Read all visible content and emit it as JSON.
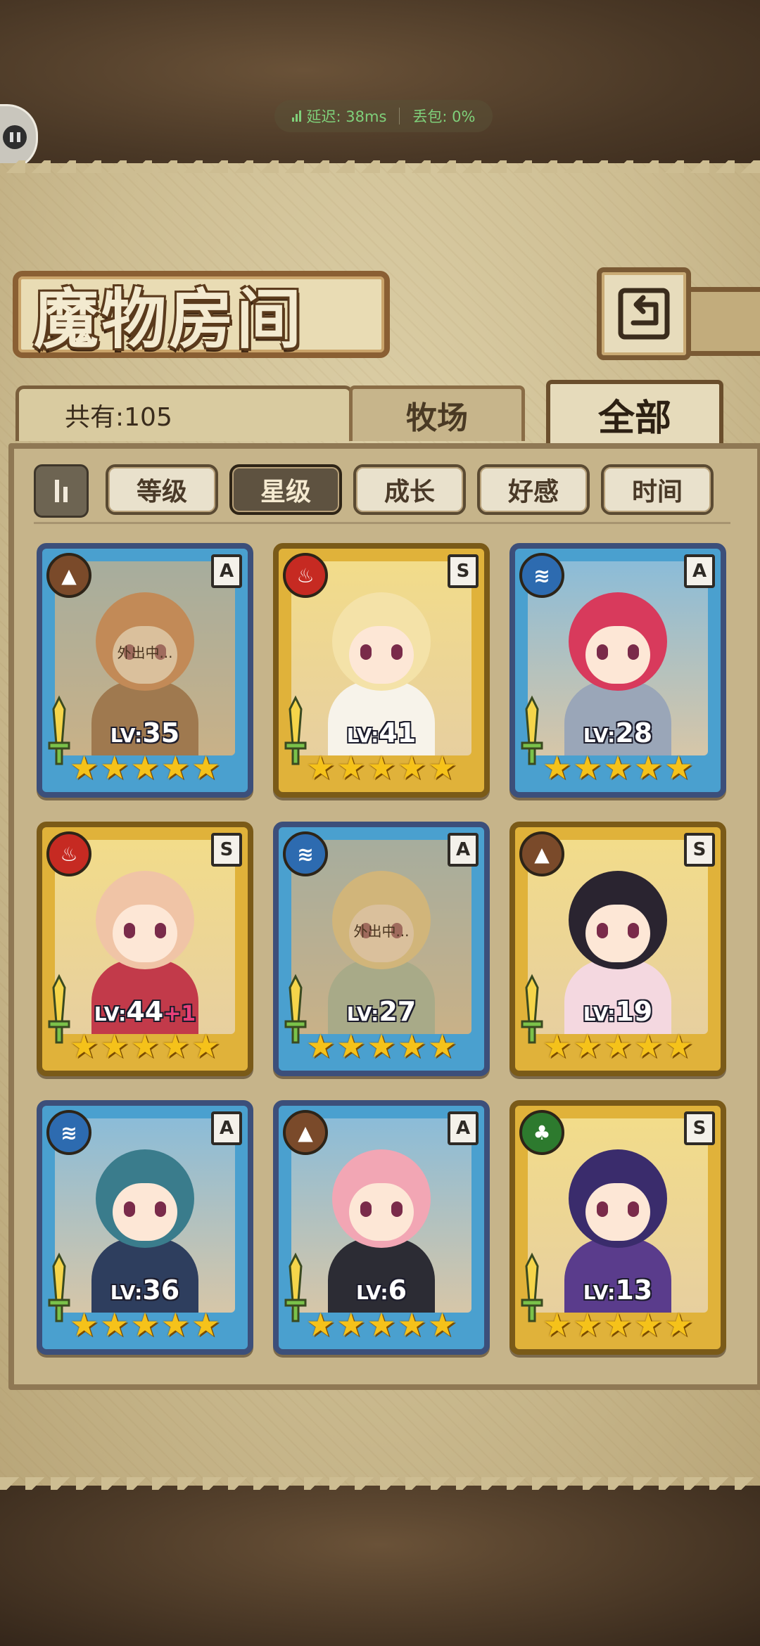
{
  "net_status": {
    "latency_label": "延迟: 38ms",
    "loss_label": "丢包: 0%"
  },
  "header": {
    "title": "魔物房间"
  },
  "count": {
    "label": "共有:105"
  },
  "tabs": [
    {
      "label": "牧场"
    },
    {
      "label": "全部",
      "active": true
    }
  ],
  "sort_buttons": [
    {
      "label": "等级",
      "active": false
    },
    {
      "label": "星级",
      "active": true
    },
    {
      "label": "成长",
      "active": false
    },
    {
      "label": "好感",
      "active": false
    },
    {
      "label": "时间",
      "active": false
    }
  ],
  "away_label": "外出中...",
  "monsters": [
    {
      "element": "earth",
      "rank": "A",
      "level_prefix": "LV:",
      "level": "35",
      "bonus": "",
      "stars": 5,
      "away": true,
      "hair": "#c8703c",
      "outfit": "#7a4a2a"
    },
    {
      "element": "fire",
      "rank": "S",
      "level_prefix": "LV:",
      "level": "41",
      "bonus": "",
      "stars": 5,
      "away": false,
      "hair": "#f4e2a8",
      "outfit": "#f7f3ea"
    },
    {
      "element": "water",
      "rank": "A",
      "level_prefix": "LV:",
      "level": "28",
      "bonus": "",
      "stars": 5,
      "away": false,
      "hair": "#d83a5c",
      "outfit": "#9aa6b8"
    },
    {
      "element": "fire",
      "rank": "S",
      "level_prefix": "LV:",
      "level": "44",
      "bonus": "+1",
      "stars": 5,
      "away": false,
      "hair": "#f0c4a6",
      "outfit": "#c23a4a"
    },
    {
      "element": "water",
      "rank": "A",
      "level_prefix": "LV:",
      "level": "27",
      "bonus": "",
      "stars": 5,
      "away": true,
      "hair": "#e8cf8a",
      "outfit": "#8fb6a8"
    },
    {
      "element": "earth",
      "rank": "S",
      "level_prefix": "LV:",
      "level": "19",
      "bonus": "",
      "stars": 5,
      "away": false,
      "hair": "#2a2430",
      "outfit": "#f4d8e0"
    },
    {
      "element": "water",
      "rank": "A",
      "level_prefix": "LV:",
      "level": "36",
      "bonus": "",
      "stars": 5,
      "away": false,
      "hair": "#3a7c8c",
      "outfit": "#2e3e5e"
    },
    {
      "element": "earth",
      "rank": "A",
      "level_prefix": "LV:",
      "level": "6",
      "bonus": "",
      "stars": 5,
      "away": false,
      "hair": "#f2a6b4",
      "outfit": "#2c2c34"
    },
    {
      "element": "wind",
      "rank": "S",
      "level_prefix": "LV:",
      "level": "13",
      "bonus": "",
      "stars": 5,
      "away": false,
      "hair": "#3a2c6c",
      "outfit": "#5a3c8c"
    }
  ],
  "colors": {
    "rank_A": "#4aa0cf",
    "rank_S": "#e0b23a",
    "element_earth": "#7a4a2a",
    "element_fire": "#c62a22",
    "element_water": "#2d6bb0",
    "element_wind": "#2d7a2e",
    "star": "#f5c21a",
    "bonus": "#e8407a"
  }
}
